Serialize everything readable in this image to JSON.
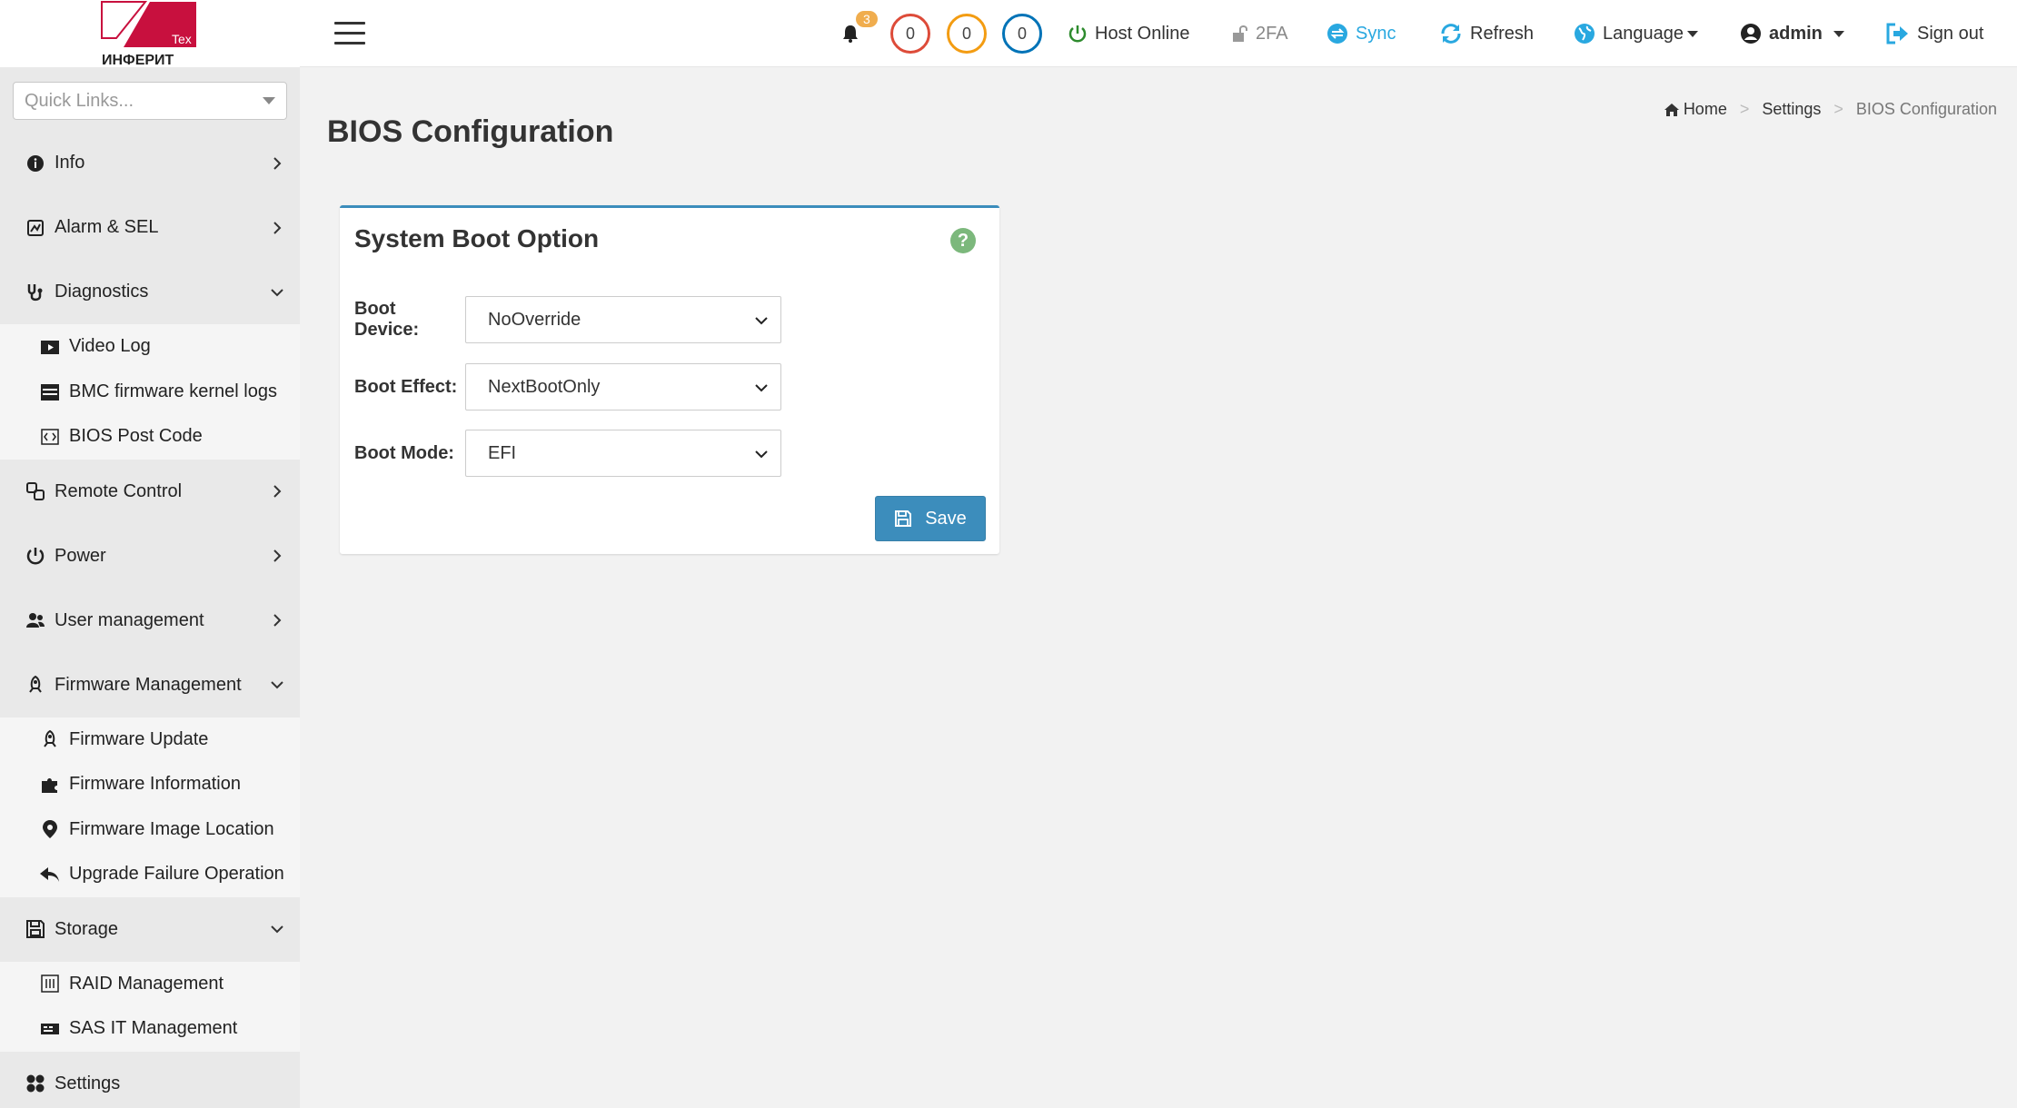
{
  "logo": {
    "brand": "ИНФЕРИТ",
    "tag": "Tex"
  },
  "quick_links": {
    "placeholder": "Quick Links..."
  },
  "sidebar": {
    "items": [
      {
        "label": "Info",
        "icon": "info-circle-icon"
      },
      {
        "label": "Alarm & SEL",
        "icon": "alarm-icon"
      },
      {
        "label": "Diagnostics",
        "icon": "stethoscope-icon",
        "expanded": true,
        "children": [
          {
            "label": "Video Log",
            "icon": "video-icon"
          },
          {
            "label": "BMC firmware kernel logs",
            "icon": "calendar-icon"
          },
          {
            "label": "BIOS Post Code",
            "icon": "code-icon"
          }
        ]
      },
      {
        "label": "Remote Control",
        "icon": "remote-icon"
      },
      {
        "label": "Power",
        "icon": "power-icon"
      },
      {
        "label": "User management",
        "icon": "users-icon"
      },
      {
        "label": "Firmware Management",
        "icon": "rocket-icon",
        "expanded": true,
        "children": [
          {
            "label": "Firmware Update",
            "icon": "rocket-icon"
          },
          {
            "label": "Firmware Information",
            "icon": "puzzle-icon"
          },
          {
            "label": "Firmware Image Location",
            "icon": "map-pin-icon"
          },
          {
            "label": "Upgrade Failure Operation",
            "icon": "reply-icon"
          }
        ]
      },
      {
        "label": "Storage",
        "icon": "save-icon",
        "expanded": true,
        "children": [
          {
            "label": "RAID Management",
            "icon": "raid-icon"
          },
          {
            "label": "SAS IT Management",
            "icon": "sas-icon"
          }
        ]
      },
      {
        "label": "Settings",
        "icon": "grid-icon"
      }
    ]
  },
  "topbar": {
    "notifications": {
      "count": "3"
    },
    "counters": [
      {
        "value": "0",
        "color": "#dd4b39"
      },
      {
        "value": "0",
        "color": "#f39c12"
      },
      {
        "value": "0",
        "color": "#0073b7"
      }
    ],
    "host_status": "Host Online",
    "twofa": "2FA",
    "sync": "Sync",
    "refresh": "Refresh",
    "language": "Language",
    "user": "admin",
    "signout": "Sign out"
  },
  "page": {
    "title": "BIOS Configuration"
  },
  "breadcrumb": {
    "home": "Home",
    "settings": "Settings",
    "current": "BIOS Configuration"
  },
  "card": {
    "title": "System Boot Option",
    "fields": {
      "boot_device": {
        "label": "Boot Device:",
        "value": "NoOverride"
      },
      "boot_effect": {
        "label": "Boot Effect:",
        "value": "NextBootOnly"
      },
      "boot_mode": {
        "label": "Boot Mode:",
        "value": "EFI"
      }
    },
    "save_label": "Save"
  },
  "colors": {
    "accent": "#3c8dbc",
    "host_online": "#2e8b2e",
    "sync": "#29a8e0",
    "help": "#7cb87c"
  }
}
